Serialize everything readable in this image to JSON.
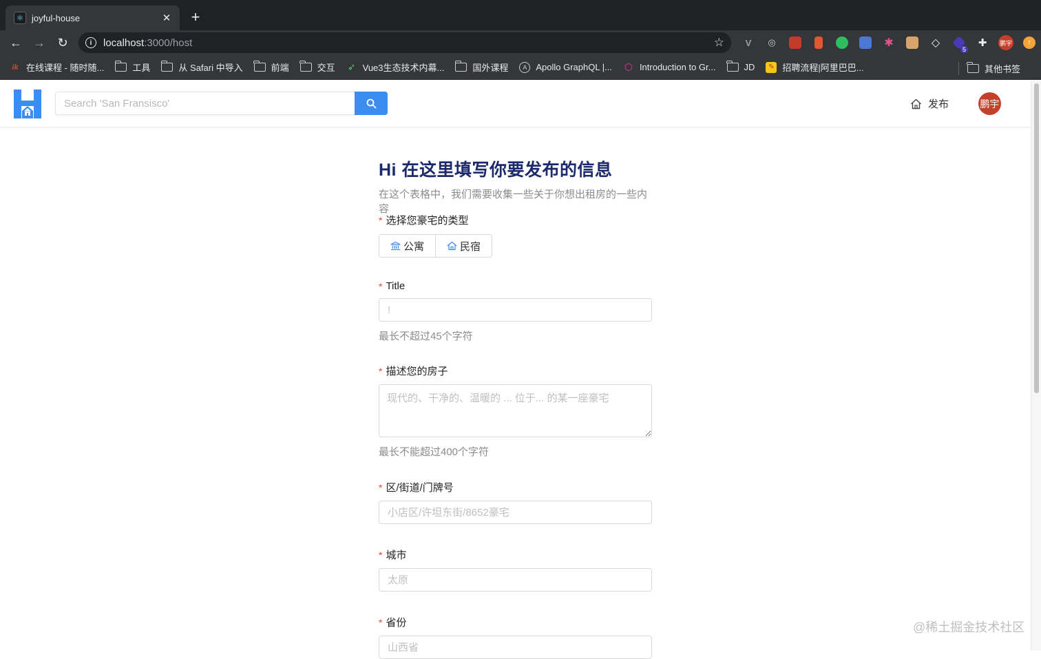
{
  "browser": {
    "tab_title": "joyful-house",
    "url_host": "localhost",
    "url_path": ":3000/host",
    "bookmarks": [
      {
        "label": "在线课程 - 随时随..."
      },
      {
        "label": "工具"
      },
      {
        "label": "从 Safari 中导入"
      },
      {
        "label": "前端"
      },
      {
        "label": "交互"
      },
      {
        "label": "Vue3生态技术内幕..."
      },
      {
        "label": "国外课程"
      },
      {
        "label": "Apollo GraphQL |..."
      },
      {
        "label": "Introduction to Gr..."
      },
      {
        "label": "JD"
      },
      {
        "label": "招聘流程|阿里巴巴..."
      }
    ],
    "other_bookmarks": "其他书签",
    "profile_label": "鹏宇",
    "ext_badge": "5"
  },
  "header": {
    "search_placeholder": "Search 'San Fransisco'",
    "publish_label": "发布",
    "avatar_label": "鹏宇"
  },
  "form": {
    "title": "Hi 在这里填写你要发布的信息",
    "subtitle": "在这个表格中，我们需要收集一些关于你想出租房的一些内容",
    "type_label": "选择您豪宅的类型",
    "type_options": [
      {
        "label": "公寓"
      },
      {
        "label": "民宿"
      }
    ],
    "title_label": "Title",
    "title_placeholder": "!",
    "title_hint": "最长不超过45个字符",
    "desc_label": "描述您的房子",
    "desc_placeholder": "现代的、干净的、温暖的 ... 位于... 的某一座豪宅",
    "desc_hint": "最长不能超过400个字符",
    "address_label": "区/街道/门牌号",
    "address_placeholder": "小店区/许坦东街/8652豪宅",
    "city_label": "城市",
    "city_placeholder": "太原",
    "province_label": "省份",
    "province_placeholder": "山西省"
  },
  "watermark": "@稀土掘金技术社区",
  "colors": {
    "accent": "#3d8cf0",
    "title": "#1c2a6b",
    "required": "#f04134",
    "avatar": "#c4402b"
  }
}
